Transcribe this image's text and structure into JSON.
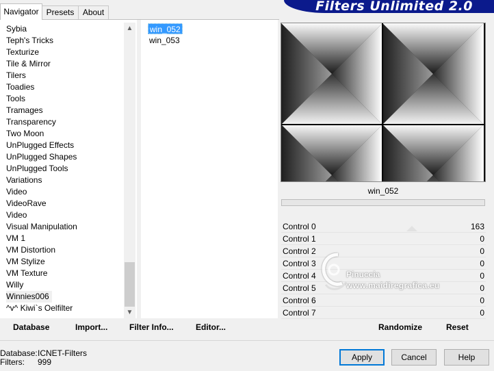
{
  "tabs": [
    {
      "label": "Navigator",
      "active": true
    },
    {
      "label": "Presets",
      "active": false
    },
    {
      "label": "About",
      "active": false
    }
  ],
  "banner": {
    "title": "Filters Unlimited 2.0",
    "color": "#0b1a8c"
  },
  "categories": [
    "Sybia",
    "Teph's Tricks",
    "Texturize",
    "Tile & Mirror",
    "Tilers",
    "Toadies",
    "Tools",
    "Tramages",
    "Transparency",
    "Two Moon",
    "UnPlugged Effects",
    "UnPlugged Shapes",
    "UnPlugged Tools",
    "Variations",
    "Video",
    "VideoRave",
    "Video",
    "Visual Manipulation",
    "VM 1",
    "VM Distortion",
    "VM Stylize",
    "VM Texture",
    "Willy",
    "Winnies006",
    "^v^ Kiwi`s Oelfilter"
  ],
  "selected_category_index": 23,
  "filters": [
    "win_052",
    "win_053"
  ],
  "selected_filter_index": 0,
  "preview": {
    "name": "win_052"
  },
  "controls": [
    {
      "label": "Control 0",
      "value": "163",
      "level": 0.64
    },
    {
      "label": "Control 1",
      "value": "0"
    },
    {
      "label": "Control 2",
      "value": "0"
    },
    {
      "label": "Control 3",
      "value": "0"
    },
    {
      "label": "Control 4",
      "value": "0"
    },
    {
      "label": "Control 5",
      "value": "0"
    },
    {
      "label": "Control 6",
      "value": "0"
    },
    {
      "label": "Control 7",
      "value": "0"
    }
  ],
  "watermark": {
    "name": "Pinuccia",
    "url": "www.maidiregrafica.eu"
  },
  "left_buttons": {
    "database": "Database",
    "import": "Import...",
    "filter_info": "Filter Info...",
    "editor": "Editor..."
  },
  "right_buttons": {
    "randomize": "Randomize",
    "reset": "Reset"
  },
  "footer": {
    "database_label": "Database:",
    "database_value": "ICNET-Filters",
    "filters_label": "Filters:",
    "filters_value": "999"
  },
  "dialog_buttons": {
    "apply": "Apply",
    "cancel": "Cancel",
    "help": "Help"
  },
  "scroll_icons": {
    "up": "chevron-up-icon",
    "down": "chevron-down-icon"
  }
}
